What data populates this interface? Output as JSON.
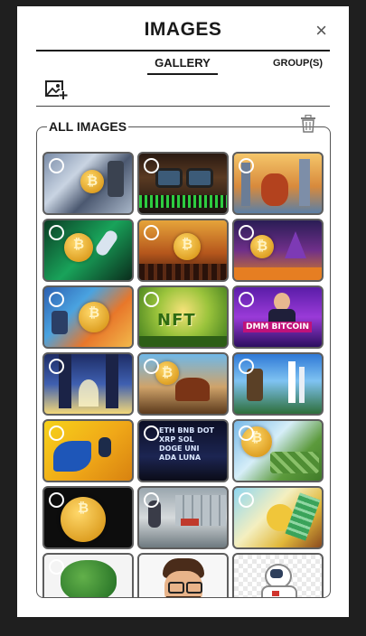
{
  "header": {
    "title": "IMAGES",
    "close_icon": "×"
  },
  "tabs": [
    {
      "label": "GALLERY",
      "active": true
    },
    {
      "label": "GROUP(S)",
      "active": false
    }
  ],
  "section": {
    "label": "ALL IMAGES"
  },
  "colors": {
    "panel": "#ffffff",
    "backdrop": "#1f1f1f",
    "tile_border": "#5e5e5e"
  },
  "images": [
    {
      "name": "city-robot-bitcoin"
    },
    {
      "name": "glasses-chart-closeup"
    },
    {
      "name": "robot-city-skyline"
    },
    {
      "name": "bitcoin-green-rocket"
    },
    {
      "name": "bitcoin-crowd-orange"
    },
    {
      "name": "bitcoin-rockets-purple"
    },
    {
      "name": "bitcoin-orange-burst"
    },
    {
      "name": "nft-sunburst-green"
    },
    {
      "name": "dmm-bitcoin-man"
    },
    {
      "name": "blue-pillars-light"
    },
    {
      "name": "bitcoin-horse-street"
    },
    {
      "name": "farmer-robot-sky"
    },
    {
      "name": "blue-robot-yellow"
    },
    {
      "name": "crypto-names-wall"
    },
    {
      "name": "gold-coins-money"
    },
    {
      "name": "gold-bitcoin-dark"
    },
    {
      "name": "man-shelf-office"
    },
    {
      "name": "money-sky-person"
    },
    {
      "name": "green-tree-cartoon"
    },
    {
      "name": "bearded-man-avatar"
    },
    {
      "name": "astronaut-figure"
    }
  ]
}
